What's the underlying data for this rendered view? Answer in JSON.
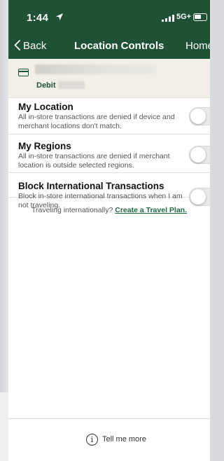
{
  "status_bar": {
    "time": "1:44",
    "network": "5G+"
  },
  "nav": {
    "back_label": "Back",
    "title": "Location Controls",
    "home_label": "Home"
  },
  "card": {
    "type_label": "Debit"
  },
  "controls": [
    {
      "title": "My Location",
      "description": "All in-store transactions are denied if device and merchant locations don't match.",
      "enabled": false
    },
    {
      "title": "My Regions",
      "description": "All in-store transactions are denied if merchant location is outside selected regions.",
      "enabled": false
    },
    {
      "title": "Block International Transactions",
      "description": "Block in-store international transactions when I am not traveling.",
      "enabled": false
    }
  ],
  "travel": {
    "prompt": "Traveling internationally?",
    "link_label": "Create a Travel Plan."
  },
  "footer": {
    "icon": "info-icon",
    "label": "Tell me more"
  },
  "colors": {
    "brand_green": "#1f5135",
    "link_green": "#1f6b3f"
  }
}
